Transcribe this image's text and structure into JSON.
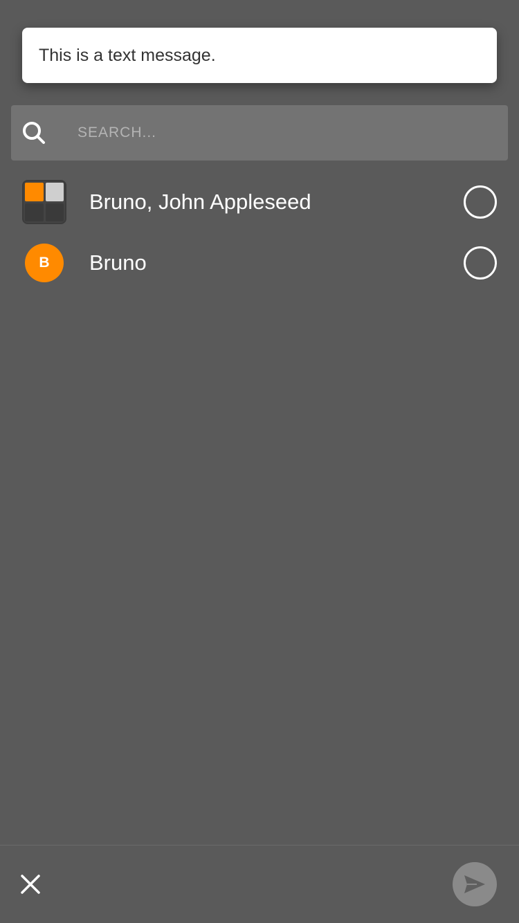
{
  "message_preview": {
    "text": "This is a text message."
  },
  "search": {
    "placeholder": "SEARCH...",
    "value": "",
    "icon": "search-icon"
  },
  "conversations": [
    {
      "label": "Bruno, John Appleseed",
      "avatar_type": "group",
      "avatar_tiles": [
        "#ff8a00",
        "#cfcfcf",
        "#3a3a3a",
        "#3a3a3a"
      ],
      "selected": false
    },
    {
      "label": "Bruno",
      "avatar_type": "initial",
      "avatar_initial": "B",
      "avatar_color": "#ff8a00",
      "selected": false
    }
  ],
  "bottom_bar": {
    "close_icon": "close-icon",
    "send_icon": "send-icon",
    "send_enabled": false
  },
  "colors": {
    "background": "#5a5a5a",
    "search_bar": "#737373",
    "accent": "#ff8a00",
    "send_button_disabled": "#8a8a8a"
  }
}
